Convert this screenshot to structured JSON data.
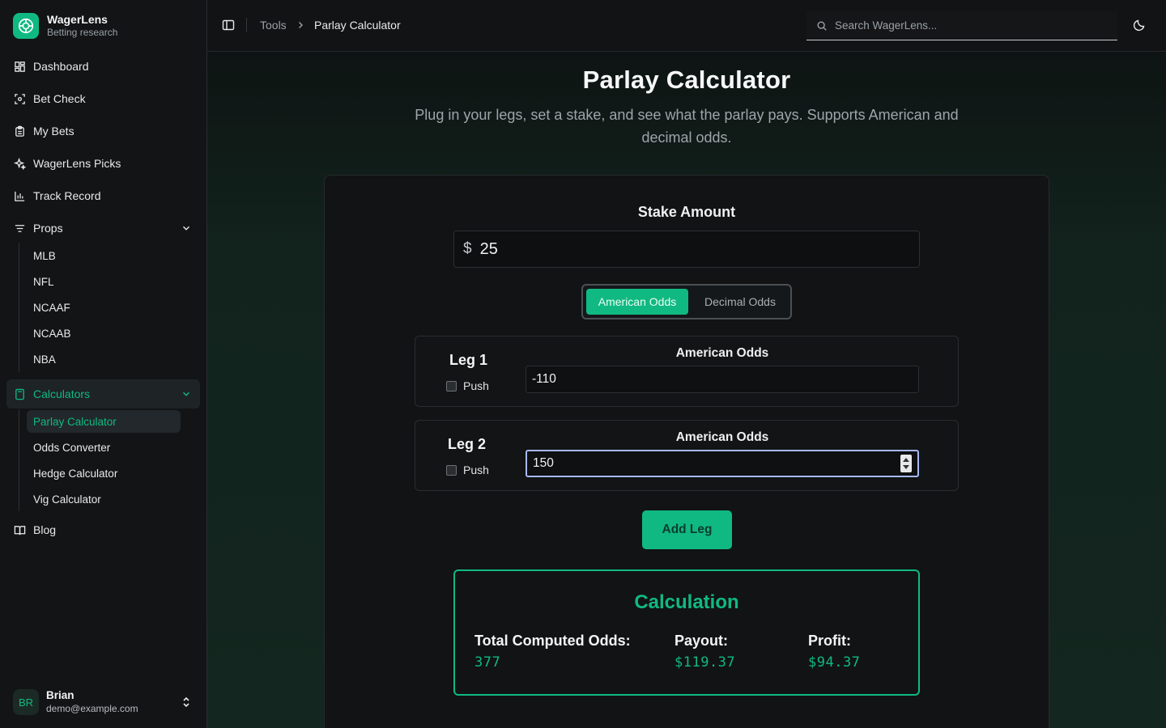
{
  "brand": {
    "name": "WagerLens",
    "subtitle": "Betting research"
  },
  "sidebar": {
    "items": [
      {
        "label": "Dashboard",
        "icon": "dashboard-icon"
      },
      {
        "label": "Bet Check",
        "icon": "scan-icon"
      },
      {
        "label": "My Bets",
        "icon": "clipboard-icon"
      },
      {
        "label": "WagerLens Picks",
        "icon": "sparkles-icon"
      },
      {
        "label": "Track Record",
        "icon": "bar-chart-icon"
      },
      {
        "label": "Props",
        "icon": "filter-lines-icon"
      },
      {
        "label": "Calculators",
        "icon": "calculator-icon"
      },
      {
        "label": "Blog",
        "icon": "book-icon"
      }
    ],
    "props_children": [
      "MLB",
      "NFL",
      "NCAAF",
      "NCAAB",
      "NBA"
    ],
    "calculator_children": [
      "Parlay Calculator",
      "Odds Converter",
      "Hedge Calculator",
      "Vig Calculator"
    ],
    "active_item": "Calculators",
    "active_child": "Parlay Calculator"
  },
  "user": {
    "initials": "BR",
    "name": "Brian",
    "email": "demo@example.com"
  },
  "topbar": {
    "breadcrumb": [
      "Tools",
      "Parlay Calculator"
    ],
    "search_placeholder": "Search WagerLens..."
  },
  "page": {
    "title": "Parlay Calculator",
    "description": "Plug in your legs, set a stake, and see what the parlay pays. Supports American and decimal odds."
  },
  "calculator": {
    "stake_label": "Stake Amount",
    "currency_symbol": "$",
    "stake_value": "25",
    "odds_modes": [
      "American Odds",
      "Decimal Odds"
    ],
    "selected_mode": "American Odds",
    "legs": [
      {
        "title": "Leg 1",
        "push_label": "Push",
        "push_checked": false,
        "odds_label": "American Odds",
        "odds_value": "-110"
      },
      {
        "title": "Leg 2",
        "push_label": "Push",
        "push_checked": false,
        "odds_label": "American Odds",
        "odds_value": "150"
      }
    ],
    "add_leg_label": "Add Leg",
    "result": {
      "title": "Calculation",
      "total_odds_label": "Total Computed Odds:",
      "total_odds_value": "377",
      "payout_label": "Payout:",
      "payout_value": "$119.37",
      "profit_label": "Profit:",
      "profit_value": "$94.37"
    }
  },
  "colors": {
    "accent": "#10b981",
    "background": "#0f1112",
    "focus_ring": "#a8b8ff"
  }
}
